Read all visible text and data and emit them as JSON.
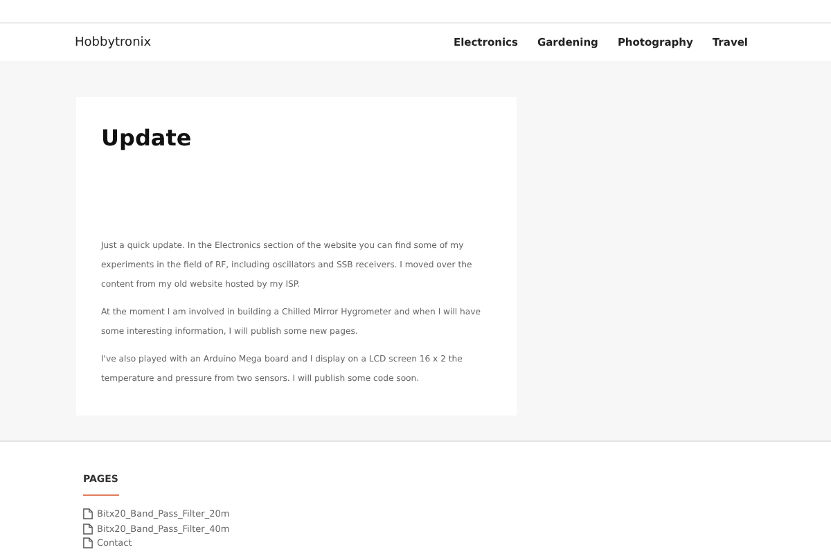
{
  "site_title": "Hobbytronix",
  "nav": [
    {
      "label": "Electronics"
    },
    {
      "label": "Gardening"
    },
    {
      "label": "Photography"
    },
    {
      "label": "Travel"
    }
  ],
  "post": {
    "title": "Update",
    "paragraphs": [
      "Just a quick update. In the Electronics section of the website you can find some of my experiments in the field of RF, including oscillators and SSB receivers. I moved over the content from my old website hosted by my ISP.",
      "At the moment I am involved in building a Chilled Mirror Hygrometer and when I will have some interesting information, I will publish some new pages.",
      "I've also played with an Arduino Mega board and I display on a LCD screen 16 x 2 the temperature and pressure from two sensors. I will publish some code soon."
    ]
  },
  "footer": {
    "heading": "PAGES",
    "pages": [
      "Bitx20_Band_Pass_Filter_20m",
      "Bitx20_Band_Pass_Filter_40m",
      "Contact"
    ]
  }
}
